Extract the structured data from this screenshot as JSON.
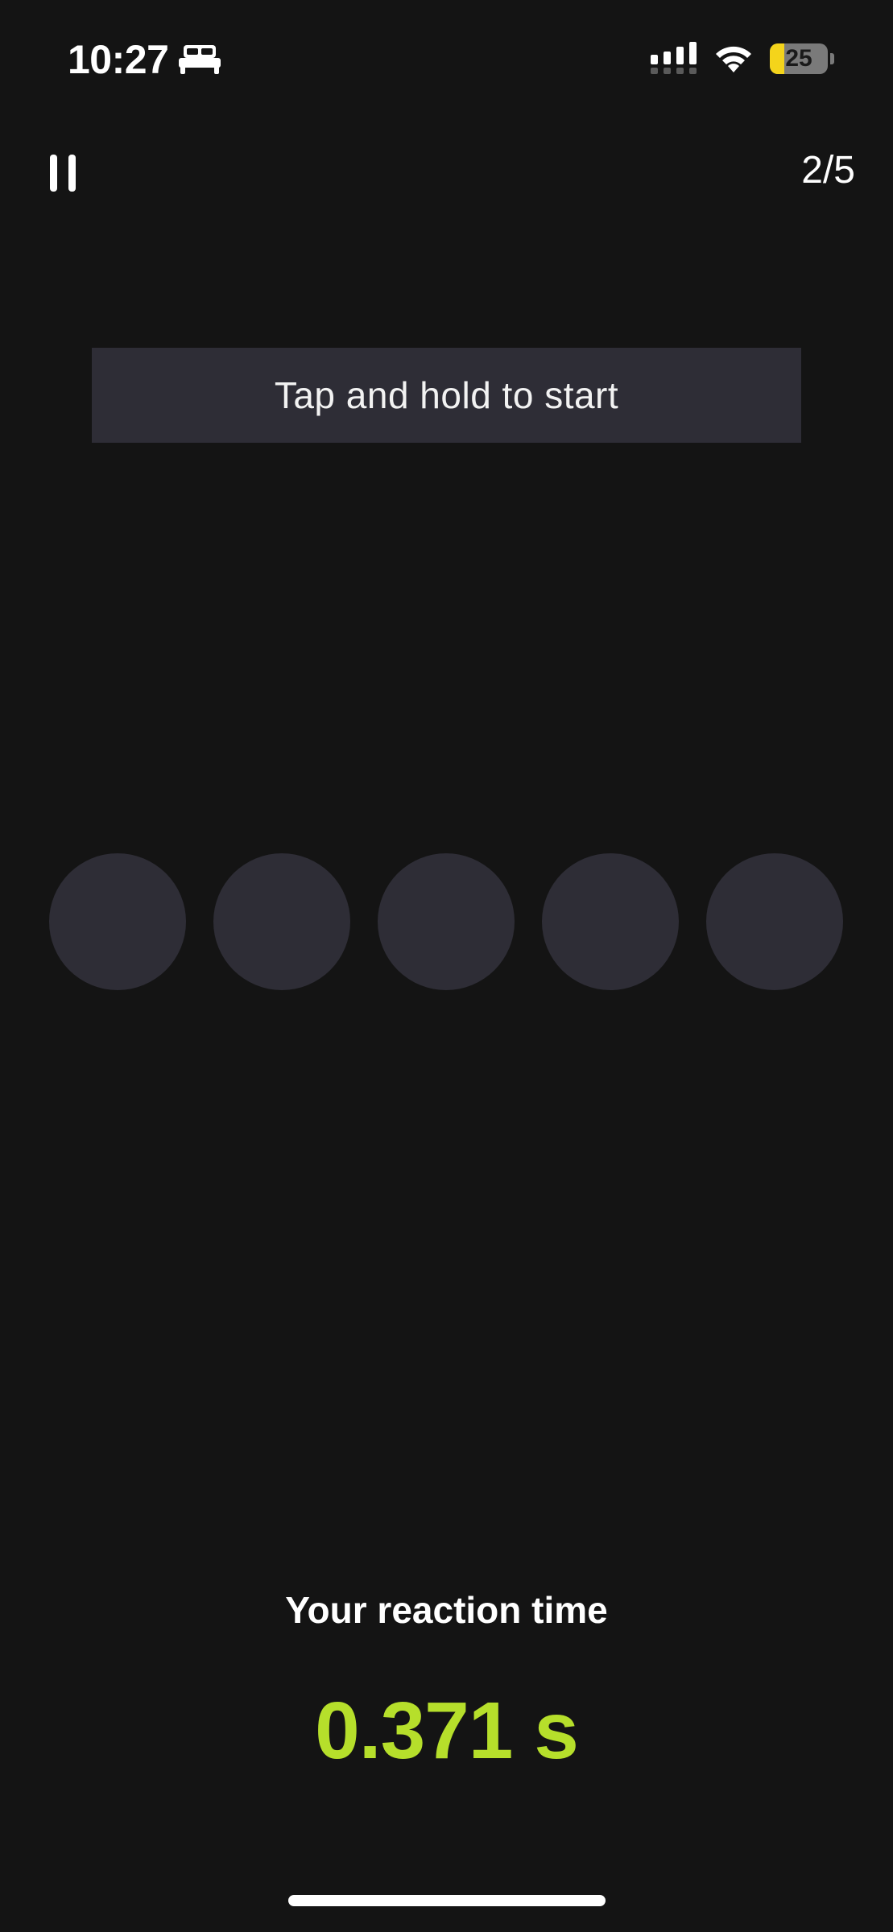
{
  "status_bar": {
    "time": "10:27",
    "battery_level": 25,
    "battery_label": "25",
    "focus_icon": "bed-icon",
    "signal_icon": "cellular-signal-icon",
    "wifi_icon": "wifi-icon",
    "battery_fill_color": "#f4d41b"
  },
  "header": {
    "pause_icon": "pause-icon",
    "round_counter": "2/5"
  },
  "instruction": {
    "text": "Tap and hold to start"
  },
  "lights": {
    "count": 5,
    "lit_count": 0,
    "off_color": "#2e2d36"
  },
  "result": {
    "label": "Your reaction time",
    "value": "0.371 s",
    "value_color": "#b6df2b"
  },
  "colors": {
    "background": "#141414",
    "surface": "#2e2d36",
    "accent": "#b6df2b"
  }
}
